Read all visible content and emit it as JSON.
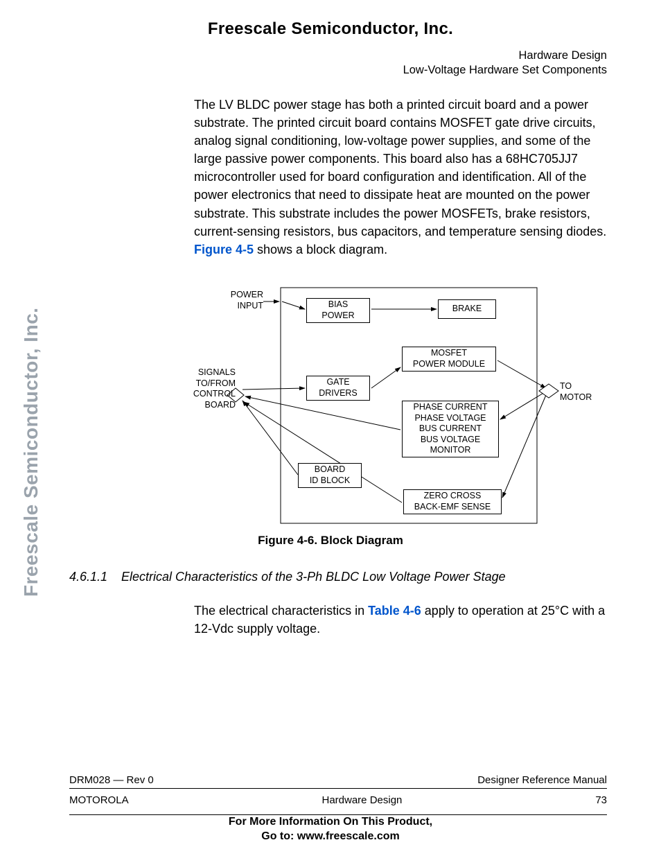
{
  "page_title": "Freescale Semiconductor, Inc.",
  "header_right": {
    "line1": "Hardware Design",
    "line2": "Low-Voltage Hardware Set Components"
  },
  "paragraph1_pre": "The LV BLDC power stage has both a printed circuit board and a power substrate. The printed circuit board contains MOSFET gate drive circuits, analog signal conditioning, low-voltage power supplies, and some of the large passive power components. This board also has a 68HC705JJ7 microcontroller used for board configuration and identification. All of the power electronics that need to dissipate heat are mounted on the power substrate. This substrate includes the power MOSFETs, brake resistors, current-sensing resistors, bus capacitors, and temperature sensing diodes. ",
  "paragraph1_xref": "Figure 4-5",
  "paragraph1_post": " shows a block diagram.",
  "sidebar_text": "Freescale Semiconductor, Inc.",
  "diagram": {
    "power_input": "POWER\nINPUT",
    "bias_power": "BIAS\nPOWER",
    "brake": "BRAKE",
    "mosfet_module": "MOSFET\nPOWER MODULE",
    "gate_drivers": "GATE\nDRIVERS",
    "sense_block": "PHASE CURRENT\nPHASE VOLTAGE\nBUS CURRENT\nBUS VOLTAGE\nMONITOR",
    "board_id": "BOARD\nID BLOCK",
    "zero_cross": "ZERO CROSS\nBACK-EMF SENSE",
    "signals_label": "SIGNALS\nTO/FROM\nCONTROL\nBOARD",
    "to_motor": "TO\nMOTOR"
  },
  "figure_caption": "Figure 4-6. Block Diagram",
  "section_number": "4.6.1.1",
  "section_title": "Electrical Characteristics of the 3-Ph BLDC Low Voltage Power Stage",
  "paragraph2_pre": "The electrical characteristics in ",
  "paragraph2_xref": "Table 4-6",
  "paragraph2_post": " apply to operation at 25°C with a 12-Vdc supply voltage.",
  "footer": {
    "doc_id": "DRM028 — Rev 0",
    "doc_type": "Designer Reference Manual",
    "vendor": "MOTOROLA",
    "chapter": "Hardware Design",
    "page_num": "73",
    "more_line1": "For More Information On This Product,",
    "more_line2": "Go to: www.freescale.com"
  }
}
